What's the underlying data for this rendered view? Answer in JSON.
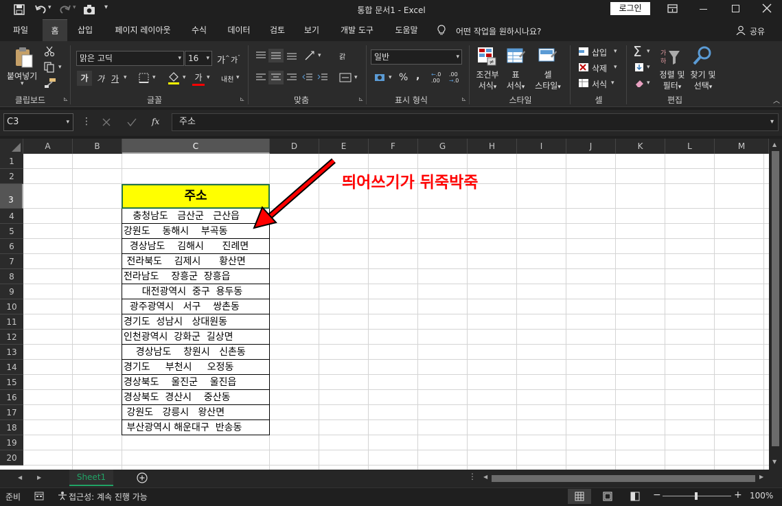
{
  "titlebar": {
    "title": "통합 문서1  -  Excel",
    "login_label": "로그인",
    "icons": [
      "save-icon",
      "undo-icon",
      "redo-icon",
      "camera-icon",
      "customize-qat-icon",
      "ribbon-display-icon",
      "minimize-icon",
      "maximize-icon",
      "close-icon"
    ]
  },
  "tabs": {
    "items": [
      "파일",
      "홈",
      "삽입",
      "페이지 레이아웃",
      "수식",
      "데이터",
      "검토",
      "보기",
      "개발 도구",
      "도움말"
    ],
    "active": "홈",
    "tell_me": "어떤 작업을 원하시나요?",
    "share": "공유"
  },
  "ribbon": {
    "clipboard": {
      "paste": "붙여넣기",
      "label": "클립보드"
    },
    "font": {
      "name": "맑은 고딕",
      "size": "16",
      "bold": "가",
      "italic": "가",
      "underline": "가",
      "font_color_glyph": "가",
      "phonetic": "내천",
      "grow": "가",
      "shrink": "가",
      "label": "글꼴",
      "highlight_color": "#ffff00",
      "font_color": "#ff0000"
    },
    "alignment": {
      "wrap": "갉",
      "label": "맞춤"
    },
    "number": {
      "format": "일반",
      "percent": "%",
      "comma": ",",
      "inc_decimal": ".00",
      "dec_decimal": ".0",
      "label": "표시 형식"
    },
    "styles": {
      "conditional": "조건부",
      "conditional2": "서식",
      "table": "표",
      "table2": "서식",
      "cell": "셀",
      "cell2": "스타일",
      "label": "스타일"
    },
    "cells": {
      "insert": "삽입",
      "delete": "삭제",
      "format": "서식",
      "label": "셀"
    },
    "editing": {
      "sort": "정렬 및",
      "sort2": "필터",
      "find": "찾기 및",
      "find2": "선택",
      "label": "편집"
    }
  },
  "formula_bar": {
    "name_box": "C3",
    "fx": "fx",
    "value": "주소"
  },
  "columns": [
    "A",
    "B",
    "C",
    "D",
    "E",
    "F",
    "G",
    "H",
    "I",
    "J",
    "K",
    "L",
    "M"
  ],
  "rows": [
    "1",
    "2",
    "3",
    "4",
    "5",
    "6",
    "7",
    "8",
    "9",
    "10",
    "11",
    "12",
    "13",
    "14",
    "15",
    "16",
    "17",
    "18",
    "19",
    "20"
  ],
  "selected_cell": "C3",
  "cells": {
    "header": "주소",
    "addresses": [
      "   충청남도   금산군   근산읍",
      "강원도    동해시    부곡동",
      "  경상남도    김해시      진례면",
      " 전라북도    김제시      황산면",
      "전라남도    장흥군  장흥읍",
      "      대전광역시  중구  용두동",
      "  광주광역시   서구    쌍촌동",
      "경기도  성남시   상대원동",
      "인천광역시  강화군  길상면",
      "    경상남도    창원시   신촌동",
      "경기도     부천시     오정동",
      "경상북도    울진군    울진읍",
      "경상북도  경산시    중산동",
      " 강원도   강릉시   왕산면",
      " 부산광역시 해운대구  반송동"
    ],
    "header_fill": "#ffff00"
  },
  "annotation": {
    "text": "띄어쓰기가 뒤죽박죽",
    "color": "#ff0000"
  },
  "sheets": {
    "tabs": [
      "Sheet1"
    ],
    "add_icon": "plus-circle-icon"
  },
  "status": {
    "ready": "준비",
    "accessibility": "접근성: 계속 진행 가능",
    "zoom": "100%",
    "zoom_minus": "−",
    "zoom_plus": "+"
  }
}
